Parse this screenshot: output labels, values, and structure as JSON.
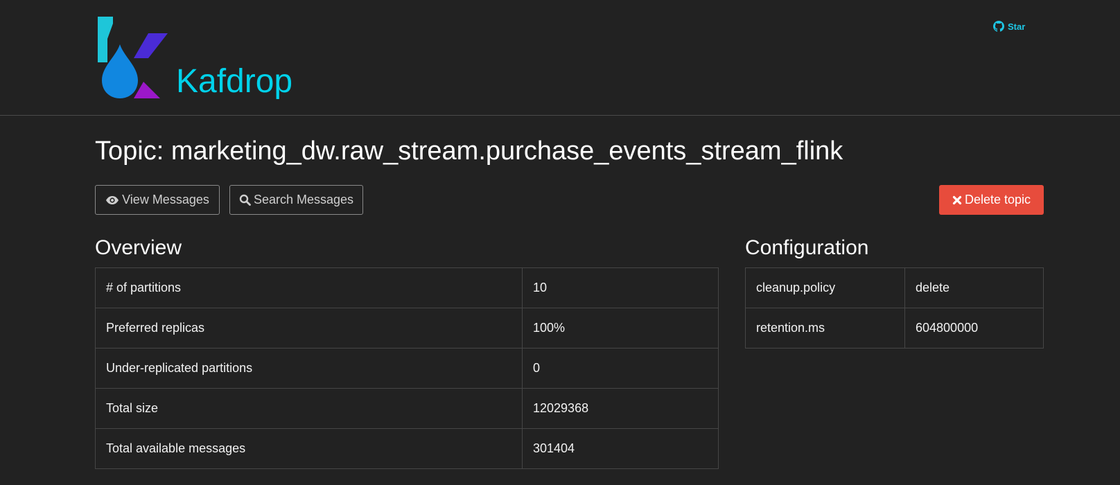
{
  "header": {
    "brand": "Kafdrop",
    "star_label": "Star"
  },
  "topic": {
    "title": "Topic: marketing_dw.raw_stream.purchase_events_stream_flink"
  },
  "actions": {
    "view_messages": "View Messages",
    "search_messages": "Search Messages",
    "delete_topic": "Delete topic"
  },
  "overview": {
    "title": "Overview",
    "rows": [
      {
        "key": "# of partitions",
        "value": "10"
      },
      {
        "key": "Preferred replicas",
        "value": "100%"
      },
      {
        "key": "Under-replicated partitions",
        "value": "0"
      },
      {
        "key": "Total size",
        "value": "12029368"
      },
      {
        "key": "Total available messages",
        "value": "301404"
      }
    ]
  },
  "configuration": {
    "title": "Configuration",
    "rows": [
      {
        "key": "cleanup.policy",
        "value": "delete"
      },
      {
        "key": "retention.ms",
        "value": "604800000"
      }
    ]
  },
  "colors": {
    "background": "#222222",
    "brand": "#00d2eb",
    "danger": "#e74c3c",
    "border": "#464646"
  },
  "icons": {
    "star": "github-icon",
    "view": "eye-icon",
    "search": "search-icon",
    "delete": "close-icon"
  }
}
